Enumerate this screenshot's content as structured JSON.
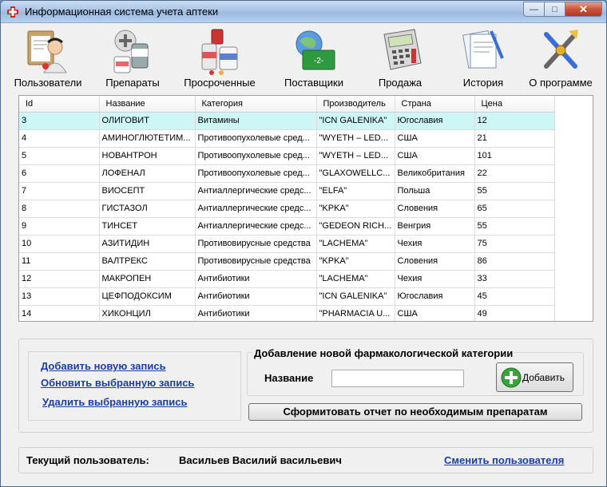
{
  "window": {
    "title": "Информационная система учета аптеки",
    "buttons": {
      "minimize": "—",
      "maximize": "□",
      "close": "✕"
    }
  },
  "toolbar": {
    "items": [
      {
        "label": "Пользователи",
        "icon": "users-icon"
      },
      {
        "label": "Препараты",
        "icon": "pills-icon"
      },
      {
        "label": "Просроченные",
        "icon": "expired-icon"
      },
      {
        "label": "Поставщики",
        "icon": "suppliers-icon"
      },
      {
        "label": "Продажа",
        "icon": "calculator-icon"
      },
      {
        "label": "История",
        "icon": "history-icon"
      },
      {
        "label": "О программе",
        "icon": "about-icon"
      }
    ]
  },
  "table": {
    "columns": [
      "Id",
      "Название",
      "Категория",
      "Производитель",
      "Страна",
      "Цена"
    ],
    "rows": [
      [
        "3",
        "ОЛИГОВИТ",
        "Витамины",
        "\"ICN GALENIKA\"",
        "Югославия",
        "12"
      ],
      [
        "4",
        "АМИНОГЛЮТЕТИМ...",
        "Противоопухолевые сред...",
        "\"WYETH – LED...",
        "США",
        "21"
      ],
      [
        "5",
        "НОВАНТРОН",
        "Противоопухолевые сред...",
        "\"WYETH – LED...",
        "США",
        "101"
      ],
      [
        "6",
        "ЛОФЕНАЛ",
        "Противоопухолевые сред...",
        "\"GLAXOWELLC...",
        "Великобритания",
        "22"
      ],
      [
        "7",
        "ВИОСЕПТ",
        "Антиаллергические средс...",
        "\"ELFA\"",
        "Польша",
        "55"
      ],
      [
        "8",
        "ГИСТАЗОЛ",
        "Антиаллергические средс...",
        "\"KPKA\"",
        "Словения",
        "65"
      ],
      [
        "9",
        "ТИНСЕТ",
        "Антиаллергические средс...",
        "\"GEDEON RICH...",
        "Венгрия",
        "55"
      ],
      [
        "10",
        "АЗИТИДИН",
        "Противовирусные средства",
        "\"LACHEMA\"",
        "Чехия",
        "75"
      ],
      [
        "11",
        "ВАЛТРЕКС",
        "Противовирусные средства",
        "\"KPKA\"",
        "Словения",
        "86"
      ],
      [
        "12",
        "МАКРОПЕН",
        "Антибиотики",
        "\"LACHEMA\"",
        "Чехия",
        "33"
      ],
      [
        "13",
        "ЦЕФПОДОКСИМ",
        "Антибиотики",
        "\"ICN GALENIKA\"",
        "Югославия",
        "45"
      ],
      [
        "14",
        "ХИКОНЦИЛ",
        "Антибиотики",
        "\"PHARMACIA U...",
        "США",
        "49"
      ]
    ],
    "selected_row": 0
  },
  "links": {
    "add": "Добавить новую запись",
    "update": "Обновить выбранную  запись",
    "delete": "Удалить выбранную запись"
  },
  "category_form": {
    "title": "Добавление новой  фармакологической категории",
    "name_label": "Название",
    "name_value": "",
    "add_button": "Добавить"
  },
  "report_button": "Сформитовать отчет по необходимым препаратам",
  "status": {
    "label": "Текущий пользователь:",
    "user": "Васильев Василий васильевич",
    "change_user": "Сменить пользователя"
  },
  "colors": {
    "selected_row": "#cdf6f7",
    "link": "#1a3ea8",
    "close_button": "#c8553c"
  }
}
